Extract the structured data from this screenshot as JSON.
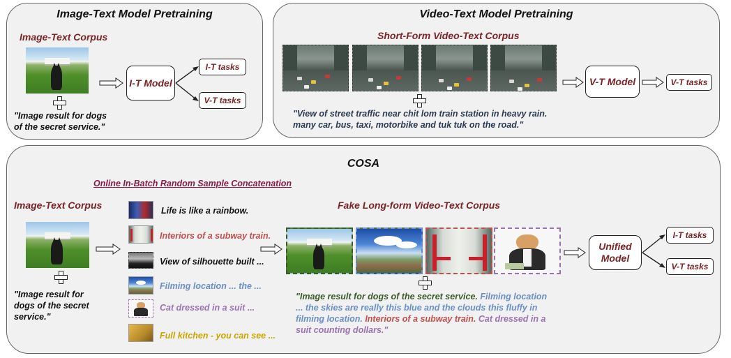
{
  "colors": {
    "corpus_title": "#7b2325",
    "video_caption": "#2b3a52",
    "sample_dark": "#111111",
    "sample_red": "#c0504d",
    "sample_blue": "#6a8fc8",
    "sample_purple": "#9a72b0",
    "sample_yellow": "#c9a400",
    "concat_link": "#8a1a4a",
    "mixed_caption_green": "#3a5a2a"
  },
  "image_text_panel": {
    "title": "Image-Text Model Pretraining",
    "corpus_title": "Image-Text Corpus",
    "caption_line1": "\"Image result for dogs",
    "caption_line2": "of the secret service.\"",
    "model_label": "I-T Model",
    "task_top": "I-T tasks",
    "task_bottom": "V-T tasks"
  },
  "video_text_panel": {
    "title": "Video-Text Model Pretraining",
    "corpus_title": "Short-Form Video-Text Corpus",
    "caption_line1": "\"View of street traffic near chit lom train station in heavy rain.",
    "caption_line2": "many car, bus, taxi, motorbike and tuk tuk on the road.\"",
    "model_label": "V-T Model",
    "task_label": "V-T tasks"
  },
  "cosa_panel": {
    "title": "COSA",
    "concat_link": "Online In-Batch Random Sample Concatenation",
    "corpus_title": "Image-Text Corpus",
    "caption_line1": "\"Image result for",
    "caption_line2": "dogs of the secret",
    "caption_line3": "service.\"",
    "samples": [
      {
        "text": "Life is like a rainbow.",
        "icon": "rainbow-thumbnail"
      },
      {
        "text": "Interiors of a subway train.",
        "icon": "subway-thumbnail"
      },
      {
        "text": "View of silhouette built ...",
        "icon": "silhouette-thumbnail"
      },
      {
        "text": "Filming location ... the ...",
        "icon": "sky-thumbnail"
      },
      {
        "text": "Cat dressed in a suit ...",
        "icon": "cat-thumbnail"
      },
      {
        "text": "Full kitchen - you can see  ...",
        "icon": "kitchen-thumbnail"
      }
    ],
    "fake_corpus_title": "Fake Long-form Video-Text Corpus",
    "combined": {
      "part1": "\"Image result for dogs of the secret service.",
      "part2": " Filming location",
      "part3": "... the skies are really this blue and the clouds this fluffy in",
      "part4": "filming location.",
      "part5": " Interiors of a subway train.",
      "part6": " Cat dressed in a",
      "part7": "suit counting dollars.\""
    },
    "model_label_line1": "Unified",
    "model_label_line2": "Model",
    "task_top": "I-T tasks",
    "task_bottom": "V-T tasks"
  }
}
